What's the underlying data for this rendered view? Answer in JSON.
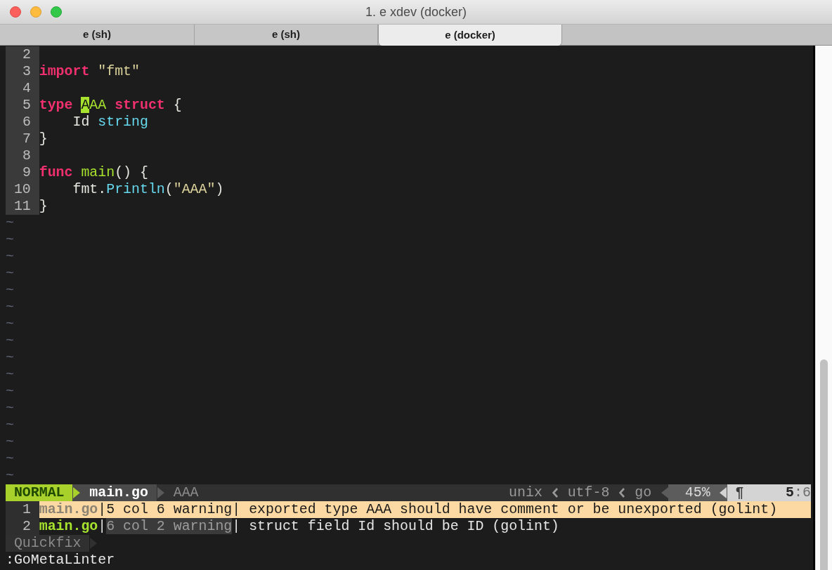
{
  "window": {
    "title": "1. e xdev (docker)"
  },
  "tabs": [
    {
      "label": "e (sh)",
      "selected": false
    },
    {
      "label": "e (sh)",
      "selected": false
    },
    {
      "label": "e (docker)",
      "selected": true
    }
  ],
  "editor": {
    "lines": [
      {
        "number": "2"
      },
      {
        "number": "3",
        "tokens": [
          {
            "kind": "keyword",
            "text": "import "
          },
          {
            "kind": "string",
            "text": "\"fmt\""
          }
        ]
      },
      {
        "number": "4"
      },
      {
        "number": "5",
        "tokens": [
          {
            "kind": "keyword",
            "text": "type "
          },
          {
            "kind": "cursor",
            "text": "A"
          },
          {
            "kind": "type",
            "text": "AA "
          },
          {
            "kind": "keyword",
            "text": "struct "
          },
          {
            "kind": "plain",
            "text": "{"
          }
        ],
        "children": [
          {
            "number": "6",
            "tokens": [
              {
                "kind": "plain",
                "text": "Id "
              },
              {
                "kind": "builtin",
                "text": "string"
              }
            ]
          }
        ]
      },
      {
        "number": "7",
        "tokens": [
          {
            "kind": "plain",
            "text": "}"
          }
        ]
      },
      {
        "number": "8"
      },
      {
        "number": "9",
        "tokens": [
          {
            "kind": "keyword",
            "text": "func "
          },
          {
            "kind": "function",
            "text": "main"
          },
          {
            "kind": "plain",
            "text": "() {"
          }
        ],
        "children": [
          {
            "number": "10",
            "tokens": [
              {
                "kind": "plain",
                "text": "fmt."
              },
              {
                "kind": "builtin",
                "text": "Println"
              },
              {
                "kind": "plain",
                "text": "("
              },
              {
                "kind": "string",
                "text": "\"AAA\""
              },
              {
                "kind": "plain",
                "text": ")"
              }
            ]
          }
        ]
      },
      {
        "number": "11",
        "tokens": [
          {
            "kind": "plain",
            "text": "}"
          }
        ]
      }
    ],
    "filler_lines": [
      "~",
      "~",
      "~",
      "~",
      "~",
      "~",
      "~",
      "~",
      "~",
      "~",
      "~",
      "~",
      "~",
      "~",
      "~",
      "~"
    ]
  },
  "status_line": {
    "mode": "NORMAL",
    "file": "main.go",
    "symbol": "AAA",
    "fileformat": "unix",
    "encoding": "utf-8",
    "filetype": "go",
    "percent": "45%",
    "line_marker": "¶",
    "position": "**5**:6"
  },
  "quickfix": {
    "items": [
      {
        "number": "1",
        "selected": true,
        "segments": [
          {
            "kind": "file",
            "text": "main.go"
          },
          {
            "kind": "separator",
            "text": "|"
          },
          {
            "kind": "location",
            "text": "5 col 6 warning"
          },
          {
            "kind": "separator",
            "text": "|"
          },
          {
            "kind": "message",
            "text": "exported type AAA should have comment or be unexported (golint)"
          }
        ]
      },
      {
        "number": "2",
        "selected": false,
        "segments": [
          {
            "kind": "file",
            "text": "main.go"
          },
          {
            "kind": "separator",
            "text": "|"
          },
          {
            "kind": "location",
            "text": "6 col 2 warning"
          },
          {
            "kind": "separator",
            "text": "|"
          },
          {
            "kind": "message",
            "text": "struct field Id should be ID (golint)"
          }
        ]
      }
    ],
    "status": "Quickfix"
  },
  "command_line": ":GoMetaLinter"
}
